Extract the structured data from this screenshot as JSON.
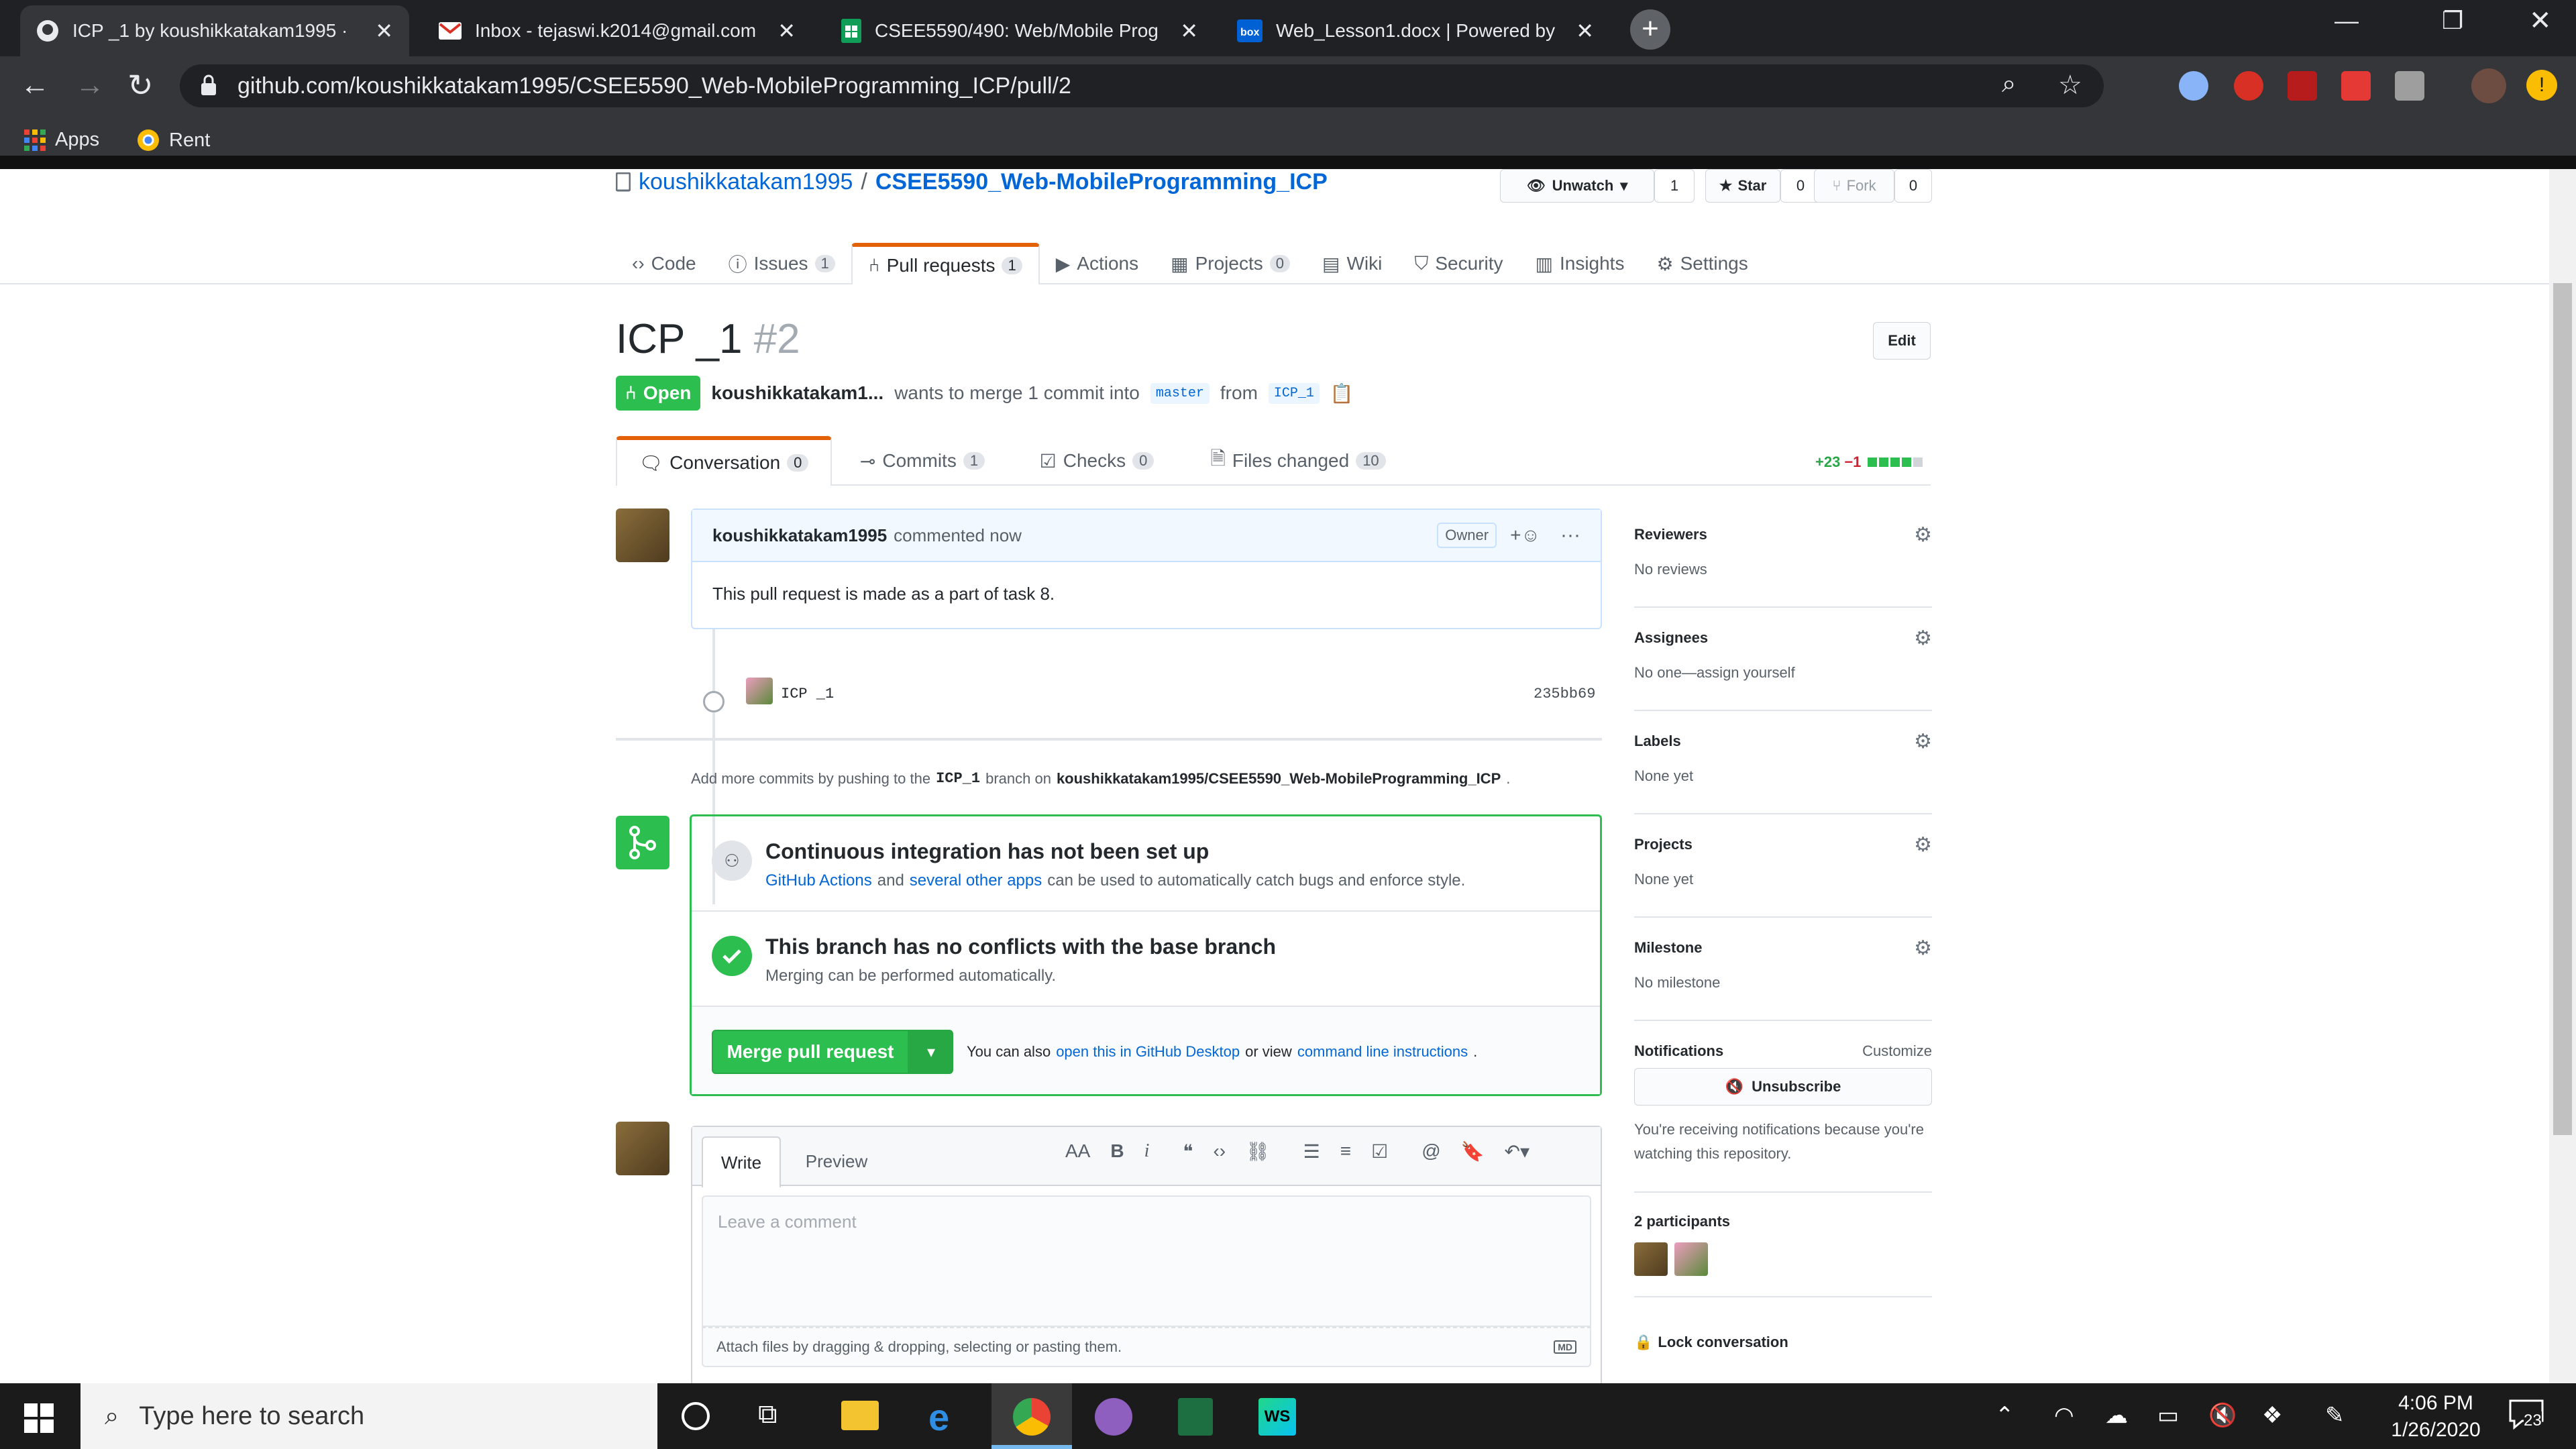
{
  "browser": {
    "tabs": [
      {
        "title": "ICP _1 by koushikkatakam1995 ·",
        "icon": "github-icon"
      },
      {
        "title": "Inbox - tejaswi.k2014@gmail.com",
        "icon": "gmail-icon"
      },
      {
        "title": "CSEE5590/490: Web/Mobile Prog",
        "icon": "sheets-icon"
      },
      {
        "title": "Web_Lesson1.docx | Powered by",
        "icon": "box-icon"
      }
    ],
    "url": "github.com/koushikkatakam1995/CSEE5590_Web-MobileProgramming_ICP/pull/2",
    "bookmarks": [
      "Apps",
      "Rent"
    ]
  },
  "repo": {
    "owner": "koushikkatakam1995",
    "sep": "/",
    "name": "CSEE5590_Web-MobileProgramming_ICP",
    "unwatch_label": "Unwatch",
    "unwatch_count": "1",
    "star_label": "Star",
    "star_count": "0",
    "fork_label": "Fork",
    "fork_count": "0"
  },
  "nav": [
    {
      "label": "Code",
      "count": ""
    },
    {
      "label": "Issues",
      "count": "1"
    },
    {
      "label": "Pull requests",
      "count": "1"
    },
    {
      "label": "Actions",
      "count": ""
    },
    {
      "label": "Projects",
      "count": "0"
    },
    {
      "label": "Wiki",
      "count": ""
    },
    {
      "label": "Security",
      "count": ""
    },
    {
      "label": "Insights",
      "count": ""
    },
    {
      "label": "Settings",
      "count": ""
    }
  ],
  "pr": {
    "title": "ICP _1",
    "number": "#2",
    "edit_label": "Edit",
    "state": "Open",
    "author": "koushikkatakam1...",
    "merge_text": "wants to merge 1 commit into",
    "base": "master",
    "from_text": "from",
    "head": "ICP_1"
  },
  "pr_tabs": [
    {
      "label": "Conversation",
      "count": "0"
    },
    {
      "label": "Commits",
      "count": "1"
    },
    {
      "label": "Checks",
      "count": "0"
    },
    {
      "label": "Files changed",
      "count": "10"
    }
  ],
  "diffstat": {
    "added": "+23",
    "removed": "−1"
  },
  "comment": {
    "author": "koushikkatakam1995",
    "time": "commented now",
    "badge": "Owner",
    "body": "This pull request is made as a part of task 8."
  },
  "commit": {
    "message": "ICP _1",
    "sha": "235bb69"
  },
  "add_more": {
    "prefix": "Add more commits by pushing to the",
    "branch": "ICP_1",
    "middle": "branch on",
    "repo": "koushikkatakam1995/CSEE5590_Web-MobileProgramming_ICP",
    "suffix": "."
  },
  "ci": {
    "title": "Continuous integration has not been set up",
    "link1": "GitHub Actions",
    "and": "and",
    "link2": "several other apps",
    "rest": "can be used to automatically catch bugs and enforce style."
  },
  "conflicts": {
    "title": "This branch has no conflicts with the base branch",
    "sub": "Merging can be performed automatically."
  },
  "merge": {
    "button": "Merge pull request",
    "also": "You can also",
    "link1": "open this in GitHub Desktop",
    "or": "or view",
    "link2": "command line instructions",
    "end": "."
  },
  "composer": {
    "write": "Write",
    "preview": "Preview",
    "placeholder": "Leave a comment",
    "attach": "Attach files by dragging & dropping, selecting or pasting them."
  },
  "sidebar": {
    "reviewers": {
      "title": "Reviewers",
      "value": "No reviews"
    },
    "assignees": {
      "title": "Assignees",
      "value": "No one—assign yourself"
    },
    "labels": {
      "title": "Labels",
      "value": "None yet"
    },
    "projects": {
      "title": "Projects",
      "value": "None yet"
    },
    "milestone": {
      "title": "Milestone",
      "value": "No milestone"
    },
    "notifications": {
      "title": "Notifications",
      "customize": "Customize",
      "button": "Unsubscribe",
      "reason": "You're receiving notifications because you're watching this repository."
    },
    "participants": "2 participants",
    "lock": "Lock conversation"
  },
  "taskbar": {
    "search_placeholder": "Type here to search",
    "time": "4:06 PM",
    "date": "1/26/2020",
    "notification_count": "23"
  },
  "colors": {
    "green": "#2cbe4e",
    "link": "#0366d6",
    "chrome_dark": "#202124"
  }
}
